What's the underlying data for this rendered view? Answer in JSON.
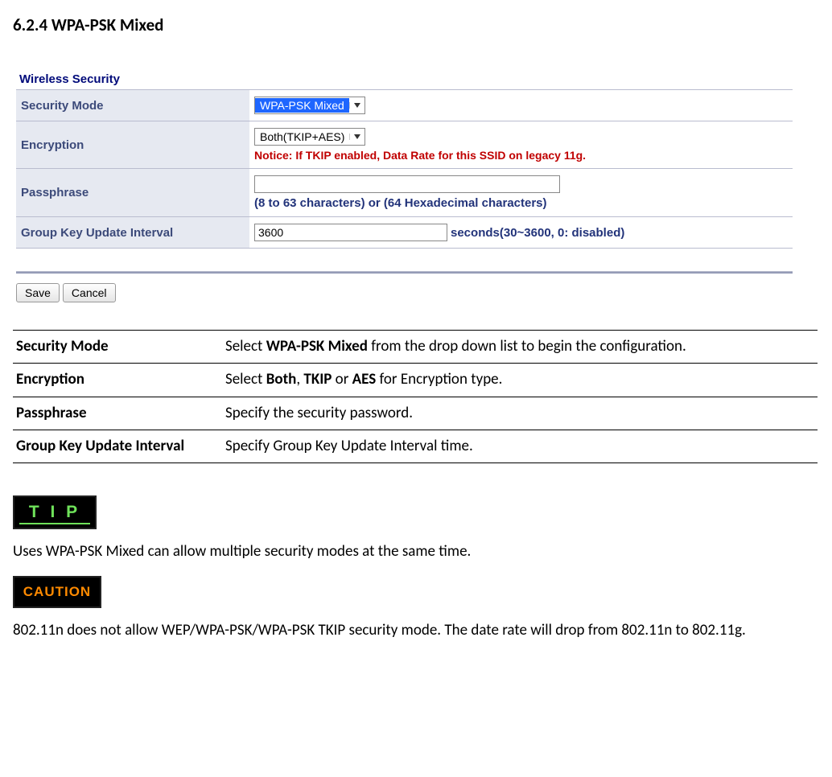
{
  "heading": "6.2.4 WPA-PSK Mixed",
  "panel": {
    "title": "Wireless Security",
    "rows": {
      "security_mode": {
        "label": "Security Mode",
        "select_value": "WPA-PSK Mixed"
      },
      "encryption": {
        "label": "Encryption",
        "select_value": "Both(TKIP+AES)",
        "notice": "Notice: If TKIP enabled, Data Rate for this SSID on legacy 11g."
      },
      "passphrase": {
        "label": "Passphrase",
        "value": "",
        "hint": "(8 to 63 characters) or (64 Hexadecimal characters)"
      },
      "group_key": {
        "label": "Group Key Update Interval",
        "value": "3600",
        "hint": "seconds(30~3600, 0: disabled)"
      }
    },
    "buttons": {
      "save": "Save",
      "cancel": "Cancel"
    }
  },
  "desc": [
    {
      "term": "Security Mode",
      "text_before": "Select ",
      "bold1": "WPA-PSK Mixed",
      "text_mid": " from the drop down list to begin the configuration.",
      "bold2": "",
      "text_mid2": "",
      "bold3": "",
      "text_after": ""
    },
    {
      "term": "Encryption",
      "text_before": "Select ",
      "bold1": "Both",
      "text_mid": ", ",
      "bold2": "TKIP",
      "text_mid2": " or ",
      "bold3": "AES",
      "text_after": " for Encryption type."
    },
    {
      "term": "Passphrase",
      "text_before": "Specify the security password.",
      "bold1": "",
      "text_mid": "",
      "bold2": "",
      "text_mid2": "",
      "bold3": "",
      "text_after": ""
    },
    {
      "term": "Group Key Update Interval",
      "text_before": "Specify Group Key Update Interval time.",
      "bold1": "",
      "text_mid": "",
      "bold2": "",
      "text_mid2": "",
      "bold3": "",
      "text_after": ""
    }
  ],
  "tip": {
    "label": "T I P",
    "text": "Uses WPA-PSK Mixed can allow multiple security modes at the same time."
  },
  "caution": {
    "label": "CAUTION",
    "text": "802.11n does not allow WEP/WPA-PSK/WPA-PSK TKIP security mode. The date rate will drop from 802.11n to 802.11g."
  }
}
